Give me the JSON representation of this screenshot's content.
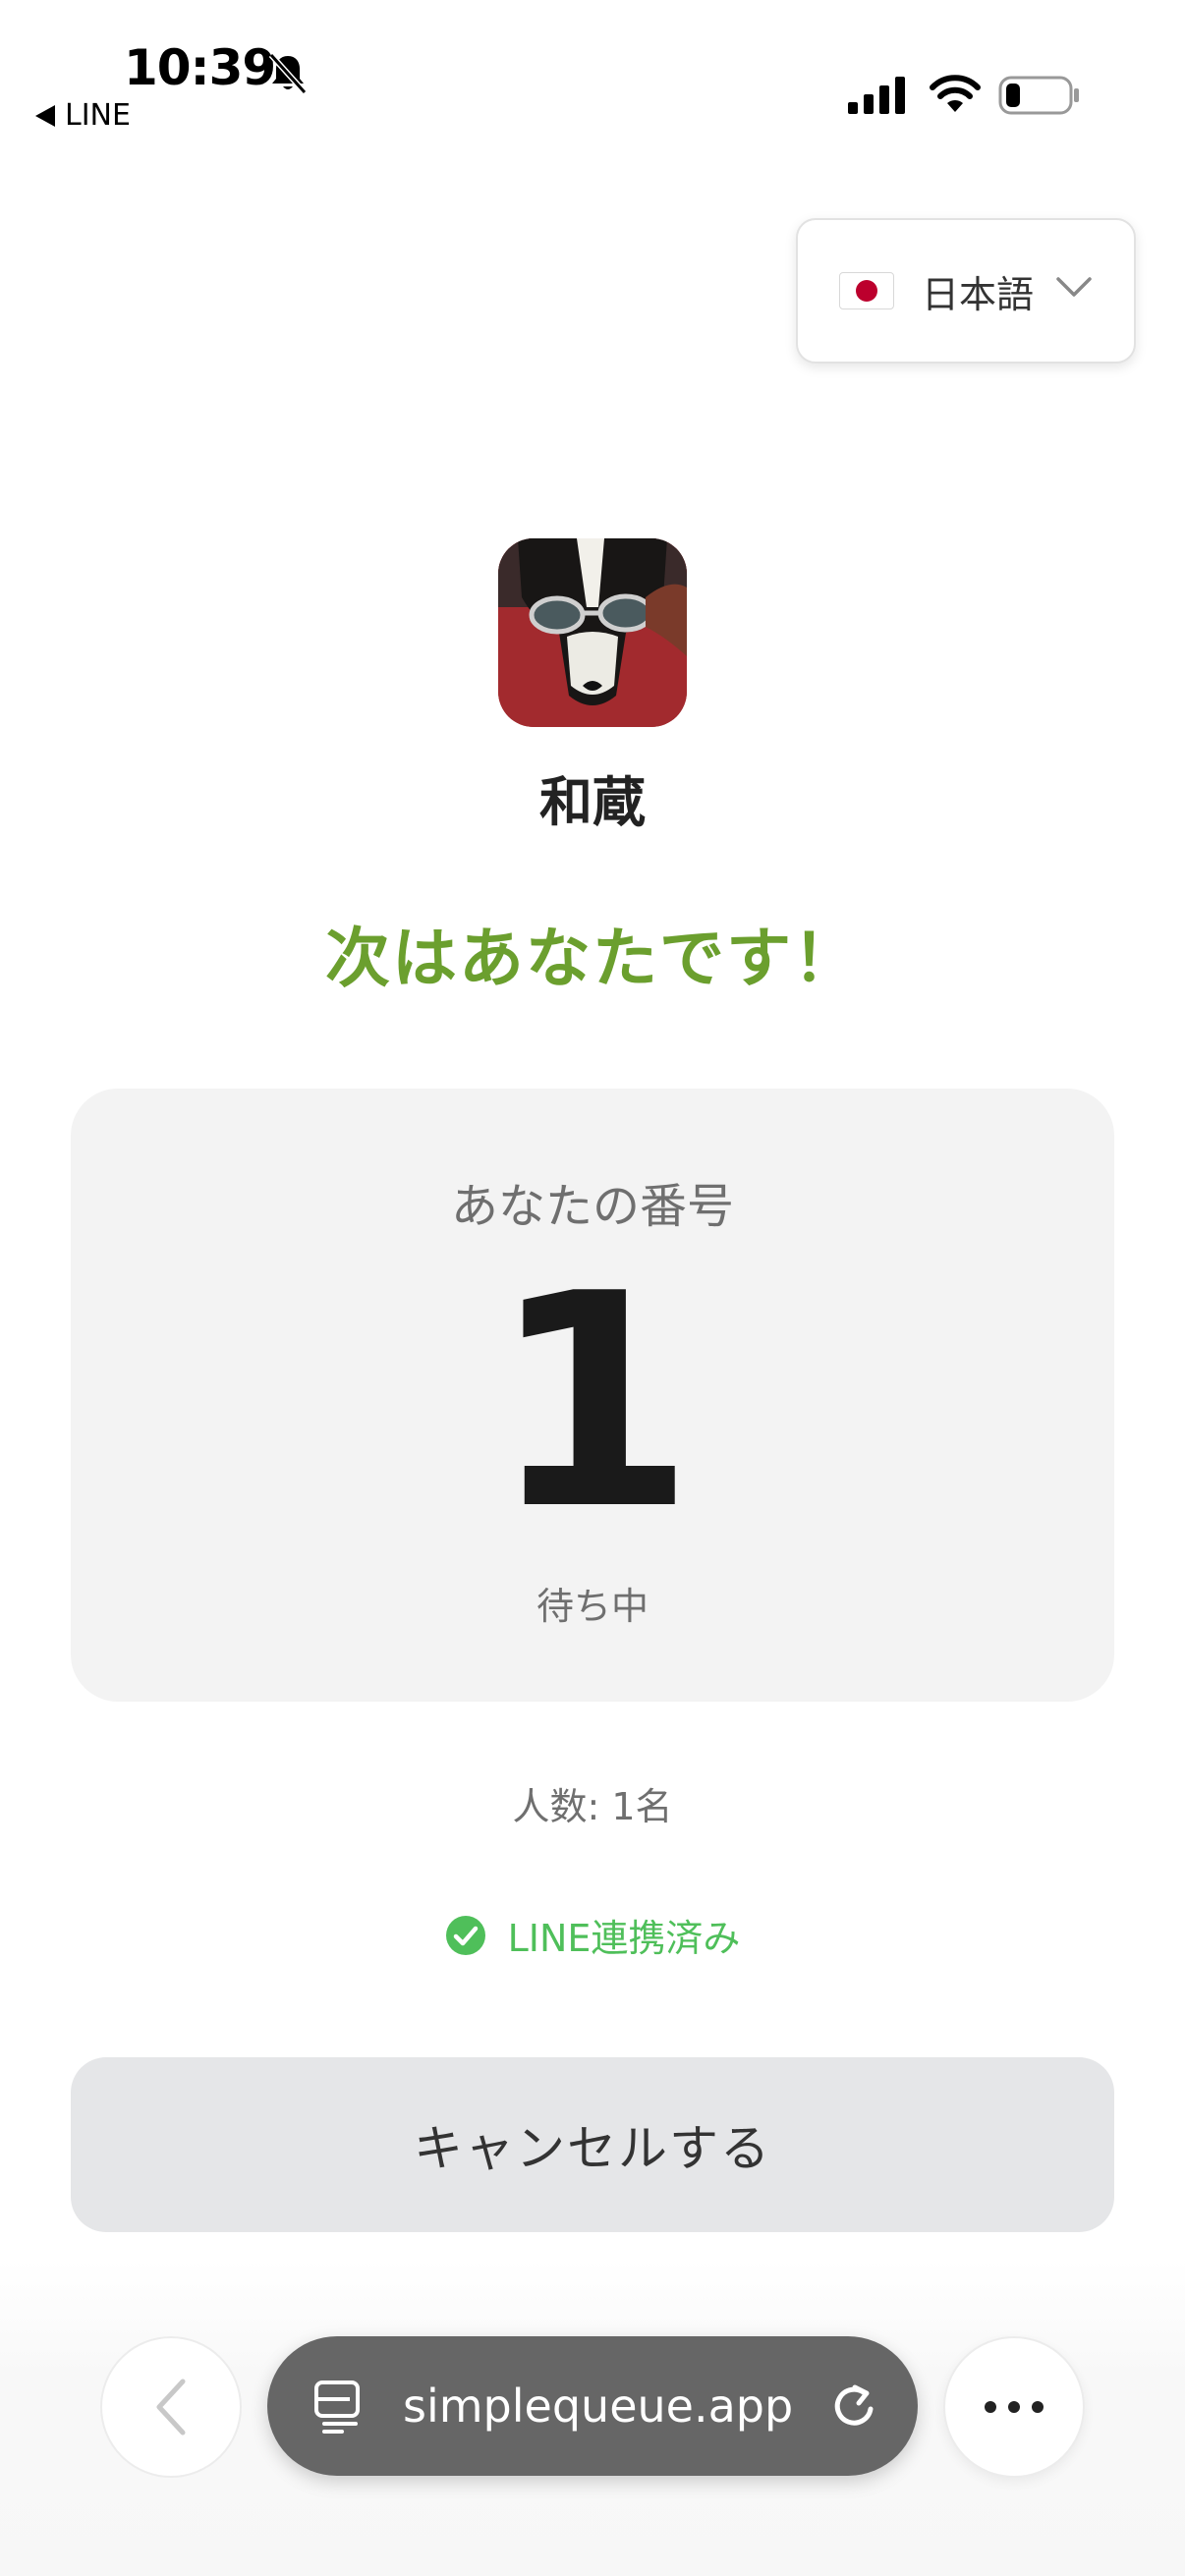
{
  "status_bar": {
    "time": "10:39",
    "back_app": "LINE",
    "icons": [
      "bell-slash-icon",
      "cellular-signal-icon",
      "wifi-icon",
      "battery-icon"
    ]
  },
  "language": {
    "flag": "japan-flag-icon",
    "selected": "日本語"
  },
  "shop": {
    "name": "和蔵"
  },
  "headline": "次はあなたです！",
  "ticket": {
    "label": "あなたの番号",
    "number": "1",
    "status": "待ち中"
  },
  "party_size": "人数: 1名",
  "line_status": {
    "text": "LINE連携済み",
    "icon": "check-circle-icon"
  },
  "cancel_label": "キャンセルする",
  "browser": {
    "url": "simplequeue.app",
    "icons": [
      "back-chevron-icon",
      "tabs-icon",
      "reload-icon",
      "more-icon"
    ]
  },
  "colors": {
    "accent_green": "#6b9f2e",
    "line_green": "#4fbf5a",
    "card_bg": "#f3f3f3",
    "button_bg": "#e5e6e8",
    "address_bar": "#666666"
  }
}
